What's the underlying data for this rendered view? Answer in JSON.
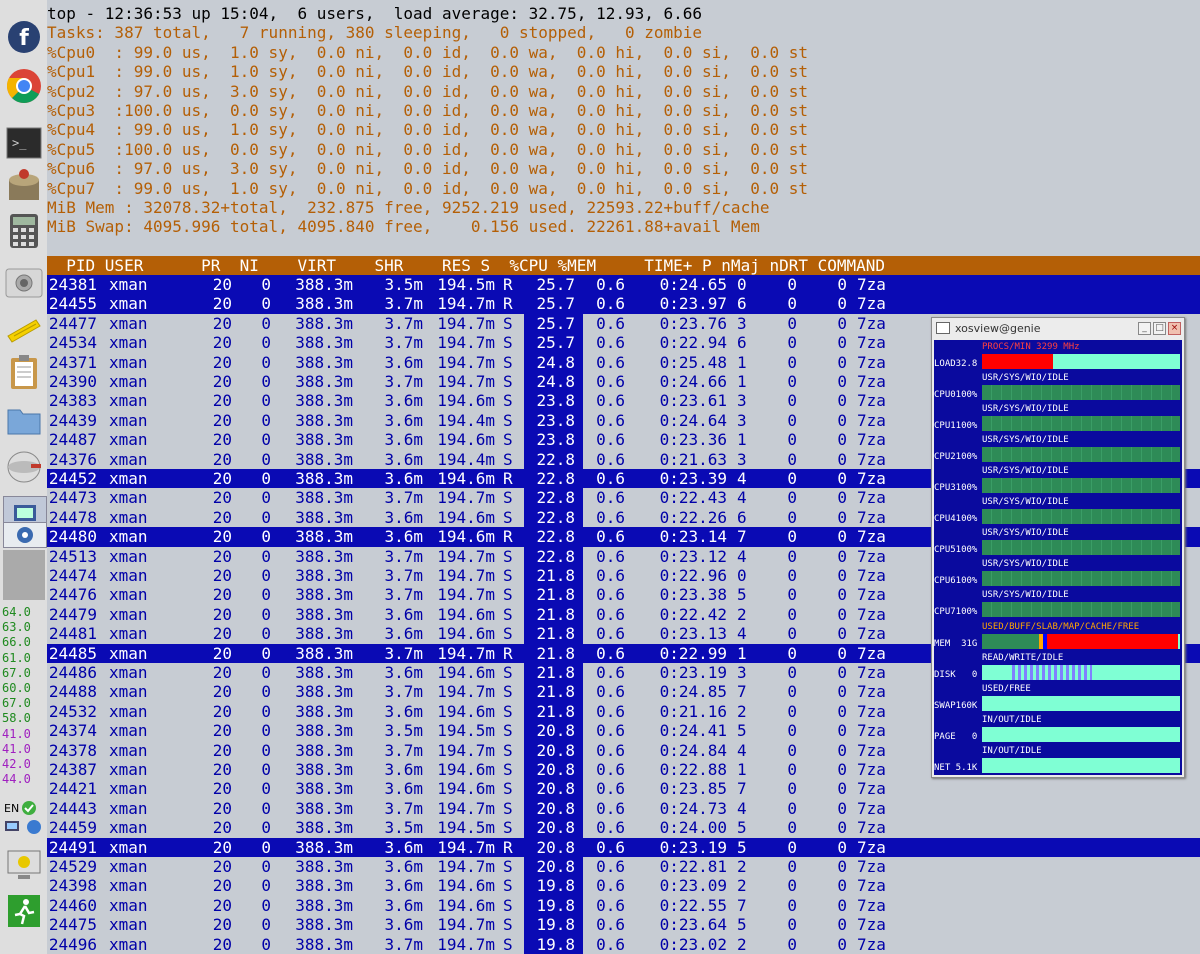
{
  "top": {
    "summary": "top - 12:36:53 up 15:04,  6 users,  load average: 32.75, 12.93, 6.66",
    "tasks": "Tasks: 387 total,   7 running, 380 sleeping,   0 stopped,   0 zombie",
    "cpus": [
      "%Cpu0  : 99.0 us,  1.0 sy,  0.0 ni,  0.0 id,  0.0 wa,  0.0 hi,  0.0 si,  0.0 st",
      "%Cpu1  : 99.0 us,  1.0 sy,  0.0 ni,  0.0 id,  0.0 wa,  0.0 hi,  0.0 si,  0.0 st",
      "%Cpu2  : 97.0 us,  3.0 sy,  0.0 ni,  0.0 id,  0.0 wa,  0.0 hi,  0.0 si,  0.0 st",
      "%Cpu3  :100.0 us,  0.0 sy,  0.0 ni,  0.0 id,  0.0 wa,  0.0 hi,  0.0 si,  0.0 st",
      "%Cpu4  : 99.0 us,  1.0 sy,  0.0 ni,  0.0 id,  0.0 wa,  0.0 hi,  0.0 si,  0.0 st",
      "%Cpu5  :100.0 us,  0.0 sy,  0.0 ni,  0.0 id,  0.0 wa,  0.0 hi,  0.0 si,  0.0 st",
      "%Cpu6  : 97.0 us,  3.0 sy,  0.0 ni,  0.0 id,  0.0 wa,  0.0 hi,  0.0 si,  0.0 st",
      "%Cpu7  : 99.0 us,  1.0 sy,  0.0 ni,  0.0 id,  0.0 wa,  0.0 hi,  0.0 si,  0.0 st"
    ],
    "mem": "MiB Mem : 32078.32+total,  232.875 free, 9252.219 used, 22593.22+buff/cache",
    "swap": "MiB Swap: 4095.996 total, 4095.840 free,    0.156 used. 22261.88+avail Mem",
    "header": "  PID USER      PR  NI    VIRT    SHR    RES S  %CPU %MEM     TIME+ P nMaj nDRT COMMAND",
    "rows": [
      {
        "pid": "24381",
        "user": "xman",
        "pr": "20",
        "ni": "0",
        "virt": "388.3m",
        "shr": "3.5m",
        "res": "194.5m",
        "s": "R",
        "cpu": "25.7",
        "mem": "0.6",
        "time": "0:24.65",
        "p": "0",
        "nmaj": "0",
        "ndrt": "0",
        "cmd": "7za",
        "sel": true
      },
      {
        "pid": "24455",
        "user": "xman",
        "pr": "20",
        "ni": "0",
        "virt": "388.3m",
        "shr": "3.7m",
        "res": "194.7m",
        "s": "R",
        "cpu": "25.7",
        "mem": "0.6",
        "time": "0:23.97",
        "p": "6",
        "nmaj": "0",
        "ndrt": "0",
        "cmd": "7za",
        "sel": true
      },
      {
        "pid": "24477",
        "user": "xman",
        "pr": "20",
        "ni": "0",
        "virt": "388.3m",
        "shr": "3.7m",
        "res": "194.7m",
        "s": "S",
        "cpu": "25.7",
        "mem": "0.6",
        "time": "0:23.76",
        "p": "3",
        "nmaj": "0",
        "ndrt": "0",
        "cmd": "7za",
        "sel": false
      },
      {
        "pid": "24534",
        "user": "xman",
        "pr": "20",
        "ni": "0",
        "virt": "388.3m",
        "shr": "3.7m",
        "res": "194.7m",
        "s": "S",
        "cpu": "25.7",
        "mem": "0.6",
        "time": "0:22.94",
        "p": "6",
        "nmaj": "0",
        "ndrt": "0",
        "cmd": "7za",
        "sel": false
      },
      {
        "pid": "24371",
        "user": "xman",
        "pr": "20",
        "ni": "0",
        "virt": "388.3m",
        "shr": "3.6m",
        "res": "194.7m",
        "s": "S",
        "cpu": "24.8",
        "mem": "0.6",
        "time": "0:25.48",
        "p": "1",
        "nmaj": "0",
        "ndrt": "0",
        "cmd": "7za",
        "sel": false
      },
      {
        "pid": "24390",
        "user": "xman",
        "pr": "20",
        "ni": "0",
        "virt": "388.3m",
        "shr": "3.7m",
        "res": "194.7m",
        "s": "S",
        "cpu": "24.8",
        "mem": "0.6",
        "time": "0:24.66",
        "p": "1",
        "nmaj": "0",
        "ndrt": "0",
        "cmd": "7za",
        "sel": false
      },
      {
        "pid": "24383",
        "user": "xman",
        "pr": "20",
        "ni": "0",
        "virt": "388.3m",
        "shr": "3.6m",
        "res": "194.6m",
        "s": "S",
        "cpu": "23.8",
        "mem": "0.6",
        "time": "0:23.61",
        "p": "3",
        "nmaj": "0",
        "ndrt": "0",
        "cmd": "7za",
        "sel": false
      },
      {
        "pid": "24439",
        "user": "xman",
        "pr": "20",
        "ni": "0",
        "virt": "388.3m",
        "shr": "3.6m",
        "res": "194.4m",
        "s": "S",
        "cpu": "23.8",
        "mem": "0.6",
        "time": "0:24.64",
        "p": "3",
        "nmaj": "0",
        "ndrt": "0",
        "cmd": "7za",
        "sel": false
      },
      {
        "pid": "24487",
        "user": "xman",
        "pr": "20",
        "ni": "0",
        "virt": "388.3m",
        "shr": "3.6m",
        "res": "194.6m",
        "s": "S",
        "cpu": "23.8",
        "mem": "0.6",
        "time": "0:23.36",
        "p": "1",
        "nmaj": "0",
        "ndrt": "0",
        "cmd": "7za",
        "sel": false
      },
      {
        "pid": "24376",
        "user": "xman",
        "pr": "20",
        "ni": "0",
        "virt": "388.3m",
        "shr": "3.6m",
        "res": "194.4m",
        "s": "S",
        "cpu": "22.8",
        "mem": "0.6",
        "time": "0:21.63",
        "p": "3",
        "nmaj": "0",
        "ndrt": "0",
        "cmd": "7za",
        "sel": false
      },
      {
        "pid": "24452",
        "user": "xman",
        "pr": "20",
        "ni": "0",
        "virt": "388.3m",
        "shr": "3.6m",
        "res": "194.6m",
        "s": "R",
        "cpu": "22.8",
        "mem": "0.6",
        "time": "0:23.39",
        "p": "4",
        "nmaj": "0",
        "ndrt": "0",
        "cmd": "7za",
        "sel": true
      },
      {
        "pid": "24473",
        "user": "xman",
        "pr": "20",
        "ni": "0",
        "virt": "388.3m",
        "shr": "3.7m",
        "res": "194.7m",
        "s": "S",
        "cpu": "22.8",
        "mem": "0.6",
        "time": "0:22.43",
        "p": "4",
        "nmaj": "0",
        "ndrt": "0",
        "cmd": "7za",
        "sel": false
      },
      {
        "pid": "24478",
        "user": "xman",
        "pr": "20",
        "ni": "0",
        "virt": "388.3m",
        "shr": "3.6m",
        "res": "194.6m",
        "s": "S",
        "cpu": "22.8",
        "mem": "0.6",
        "time": "0:22.26",
        "p": "6",
        "nmaj": "0",
        "ndrt": "0",
        "cmd": "7za",
        "sel": false
      },
      {
        "pid": "24480",
        "user": "xman",
        "pr": "20",
        "ni": "0",
        "virt": "388.3m",
        "shr": "3.6m",
        "res": "194.6m",
        "s": "R",
        "cpu": "22.8",
        "mem": "0.6",
        "time": "0:23.14",
        "p": "7",
        "nmaj": "0",
        "ndrt": "0",
        "cmd": "7za",
        "sel": true
      },
      {
        "pid": "24513",
        "user": "xman",
        "pr": "20",
        "ni": "0",
        "virt": "388.3m",
        "shr": "3.7m",
        "res": "194.7m",
        "s": "S",
        "cpu": "22.8",
        "mem": "0.6",
        "time": "0:23.12",
        "p": "4",
        "nmaj": "0",
        "ndrt": "0",
        "cmd": "7za",
        "sel": false
      },
      {
        "pid": "24474",
        "user": "xman",
        "pr": "20",
        "ni": "0",
        "virt": "388.3m",
        "shr": "3.7m",
        "res": "194.7m",
        "s": "S",
        "cpu": "21.8",
        "mem": "0.6",
        "time": "0:22.96",
        "p": "0",
        "nmaj": "0",
        "ndrt": "0",
        "cmd": "7za",
        "sel": false
      },
      {
        "pid": "24476",
        "user": "xman",
        "pr": "20",
        "ni": "0",
        "virt": "388.3m",
        "shr": "3.7m",
        "res": "194.7m",
        "s": "S",
        "cpu": "21.8",
        "mem": "0.6",
        "time": "0:23.38",
        "p": "5",
        "nmaj": "0",
        "ndrt": "0",
        "cmd": "7za",
        "sel": false
      },
      {
        "pid": "24479",
        "user": "xman",
        "pr": "20",
        "ni": "0",
        "virt": "388.3m",
        "shr": "3.6m",
        "res": "194.6m",
        "s": "S",
        "cpu": "21.8",
        "mem": "0.6",
        "time": "0:22.42",
        "p": "2",
        "nmaj": "0",
        "ndrt": "0",
        "cmd": "7za",
        "sel": false
      },
      {
        "pid": "24481",
        "user": "xman",
        "pr": "20",
        "ni": "0",
        "virt": "388.3m",
        "shr": "3.6m",
        "res": "194.6m",
        "s": "S",
        "cpu": "21.8",
        "mem": "0.6",
        "time": "0:23.13",
        "p": "4",
        "nmaj": "0",
        "ndrt": "0",
        "cmd": "7za",
        "sel": false
      },
      {
        "pid": "24485",
        "user": "xman",
        "pr": "20",
        "ni": "0",
        "virt": "388.3m",
        "shr": "3.7m",
        "res": "194.7m",
        "s": "R",
        "cpu": "21.8",
        "mem": "0.6",
        "time": "0:22.99",
        "p": "1",
        "nmaj": "0",
        "ndrt": "0",
        "cmd": "7za",
        "sel": true
      },
      {
        "pid": "24486",
        "user": "xman",
        "pr": "20",
        "ni": "0",
        "virt": "388.3m",
        "shr": "3.6m",
        "res": "194.6m",
        "s": "S",
        "cpu": "21.8",
        "mem": "0.6",
        "time": "0:23.19",
        "p": "3",
        "nmaj": "0",
        "ndrt": "0",
        "cmd": "7za",
        "sel": false
      },
      {
        "pid": "24488",
        "user": "xman",
        "pr": "20",
        "ni": "0",
        "virt": "388.3m",
        "shr": "3.7m",
        "res": "194.7m",
        "s": "S",
        "cpu": "21.8",
        "mem": "0.6",
        "time": "0:24.85",
        "p": "7",
        "nmaj": "0",
        "ndrt": "0",
        "cmd": "7za",
        "sel": false
      },
      {
        "pid": "24532",
        "user": "xman",
        "pr": "20",
        "ni": "0",
        "virt": "388.3m",
        "shr": "3.6m",
        "res": "194.6m",
        "s": "S",
        "cpu": "21.8",
        "mem": "0.6",
        "time": "0:21.16",
        "p": "2",
        "nmaj": "0",
        "ndrt": "0",
        "cmd": "7za",
        "sel": false
      },
      {
        "pid": "24374",
        "user": "xman",
        "pr": "20",
        "ni": "0",
        "virt": "388.3m",
        "shr": "3.5m",
        "res": "194.5m",
        "s": "S",
        "cpu": "20.8",
        "mem": "0.6",
        "time": "0:24.41",
        "p": "5",
        "nmaj": "0",
        "ndrt": "0",
        "cmd": "7za",
        "sel": false
      },
      {
        "pid": "24378",
        "user": "xman",
        "pr": "20",
        "ni": "0",
        "virt": "388.3m",
        "shr": "3.7m",
        "res": "194.7m",
        "s": "S",
        "cpu": "20.8",
        "mem": "0.6",
        "time": "0:24.84",
        "p": "4",
        "nmaj": "0",
        "ndrt": "0",
        "cmd": "7za",
        "sel": false
      },
      {
        "pid": "24387",
        "user": "xman",
        "pr": "20",
        "ni": "0",
        "virt": "388.3m",
        "shr": "3.6m",
        "res": "194.6m",
        "s": "S",
        "cpu": "20.8",
        "mem": "0.6",
        "time": "0:22.88",
        "p": "1",
        "nmaj": "0",
        "ndrt": "0",
        "cmd": "7za",
        "sel": false
      },
      {
        "pid": "24421",
        "user": "xman",
        "pr": "20",
        "ni": "0",
        "virt": "388.3m",
        "shr": "3.6m",
        "res": "194.6m",
        "s": "S",
        "cpu": "20.8",
        "mem": "0.6",
        "time": "0:23.85",
        "p": "7",
        "nmaj": "0",
        "ndrt": "0",
        "cmd": "7za",
        "sel": false
      },
      {
        "pid": "24443",
        "user": "xman",
        "pr": "20",
        "ni": "0",
        "virt": "388.3m",
        "shr": "3.7m",
        "res": "194.7m",
        "s": "S",
        "cpu": "20.8",
        "mem": "0.6",
        "time": "0:24.73",
        "p": "4",
        "nmaj": "0",
        "ndrt": "0",
        "cmd": "7za",
        "sel": false
      },
      {
        "pid": "24459",
        "user": "xman",
        "pr": "20",
        "ni": "0",
        "virt": "388.3m",
        "shr": "3.5m",
        "res": "194.5m",
        "s": "S",
        "cpu": "20.8",
        "mem": "0.6",
        "time": "0:24.00",
        "p": "5",
        "nmaj": "0",
        "ndrt": "0",
        "cmd": "7za",
        "sel": false
      },
      {
        "pid": "24491",
        "user": "xman",
        "pr": "20",
        "ni": "0",
        "virt": "388.3m",
        "shr": "3.6m",
        "res": "194.7m",
        "s": "R",
        "cpu": "20.8",
        "mem": "0.6",
        "time": "0:23.19",
        "p": "5",
        "nmaj": "0",
        "ndrt": "0",
        "cmd": "7za",
        "sel": true
      },
      {
        "pid": "24529",
        "user": "xman",
        "pr": "20",
        "ni": "0",
        "virt": "388.3m",
        "shr": "3.6m",
        "res": "194.7m",
        "s": "S",
        "cpu": "20.8",
        "mem": "0.6",
        "time": "0:22.81",
        "p": "2",
        "nmaj": "0",
        "ndrt": "0",
        "cmd": "7za",
        "sel": false
      },
      {
        "pid": "24398",
        "user": "xman",
        "pr": "20",
        "ni": "0",
        "virt": "388.3m",
        "shr": "3.6m",
        "res": "194.6m",
        "s": "S",
        "cpu": "19.8",
        "mem": "0.6",
        "time": "0:23.09",
        "p": "2",
        "nmaj": "0",
        "ndrt": "0",
        "cmd": "7za",
        "sel": false
      },
      {
        "pid": "24460",
        "user": "xman",
        "pr": "20",
        "ni": "0",
        "virt": "388.3m",
        "shr": "3.6m",
        "res": "194.6m",
        "s": "S",
        "cpu": "19.8",
        "mem": "0.6",
        "time": "0:22.55",
        "p": "7",
        "nmaj": "0",
        "ndrt": "0",
        "cmd": "7za",
        "sel": false
      },
      {
        "pid": "24475",
        "user": "xman",
        "pr": "20",
        "ni": "0",
        "virt": "388.3m",
        "shr": "3.6m",
        "res": "194.7m",
        "s": "S",
        "cpu": "19.8",
        "mem": "0.6",
        "time": "0:23.64",
        "p": "5",
        "nmaj": "0",
        "ndrt": "0",
        "cmd": "7za",
        "sel": false
      },
      {
        "pid": "24496",
        "user": "xman",
        "pr": "20",
        "ni": "0",
        "virt": "388.3m",
        "shr": "3.7m",
        "res": "194.7m",
        "s": "S",
        "cpu": "19.8",
        "mem": "0.6",
        "time": "0:23.02",
        "p": "2",
        "nmaj": "0",
        "ndrt": "0",
        "cmd": "7za",
        "sel": false
      }
    ]
  },
  "dock": {
    "temps_green": [
      "64.0",
      "63.0",
      "66.0",
      "61.0",
      "67.0",
      "60.0",
      "67.0",
      "58.0"
    ],
    "temps_purple": [
      "41.0",
      "41.0",
      "42.0",
      "44.0"
    ],
    "lang": "EN",
    "icons": [
      "fedora-icon",
      "chrome-icon",
      "terminal-icon",
      "package-manager-icon",
      "calculator-icon",
      "camera-icon",
      "notes-icon",
      "clipboard-icon",
      "folder-icon",
      "network-disc-icon",
      "window-list-icon",
      "remote-desktop-icon",
      "monitor-icon",
      "logout-icon"
    ]
  },
  "xosview": {
    "title": "xosview@genie",
    "load_legend": "PROCS/MIN 3299 MHz",
    "load_label": "LOAD32.8",
    "cpu_legend": "USR/SYS/WIO/IDLE",
    "cpu_labels": [
      "CPU0100%",
      "CPU1100%",
      "CPU2100%",
      "CPU3100%",
      "CPU4100%",
      "CPU5100%",
      "CPU6100%",
      "CPU7100%"
    ],
    "mem_legend": "USED/BUFF/SLAB/MAP/CACHE/FREE",
    "mem_label": "MEM  31G",
    "disk_legend": "READ/WRITE/IDLE",
    "disk_label": "DISK   0",
    "swap_legend": "USED/FREE",
    "swap_label": "SWAP160K",
    "page_legend": "IN/OUT/IDLE",
    "page_label": "PAGE   0",
    "net_legend": "IN/OUT/IDLE",
    "net_label": "NET 5.1K",
    "colors": {
      "bg": "#0a0a9e",
      "cpu": "#2e8b57",
      "load": "#ff0000",
      "idle": "#7fffd4",
      "accent": "#ffa500"
    }
  }
}
